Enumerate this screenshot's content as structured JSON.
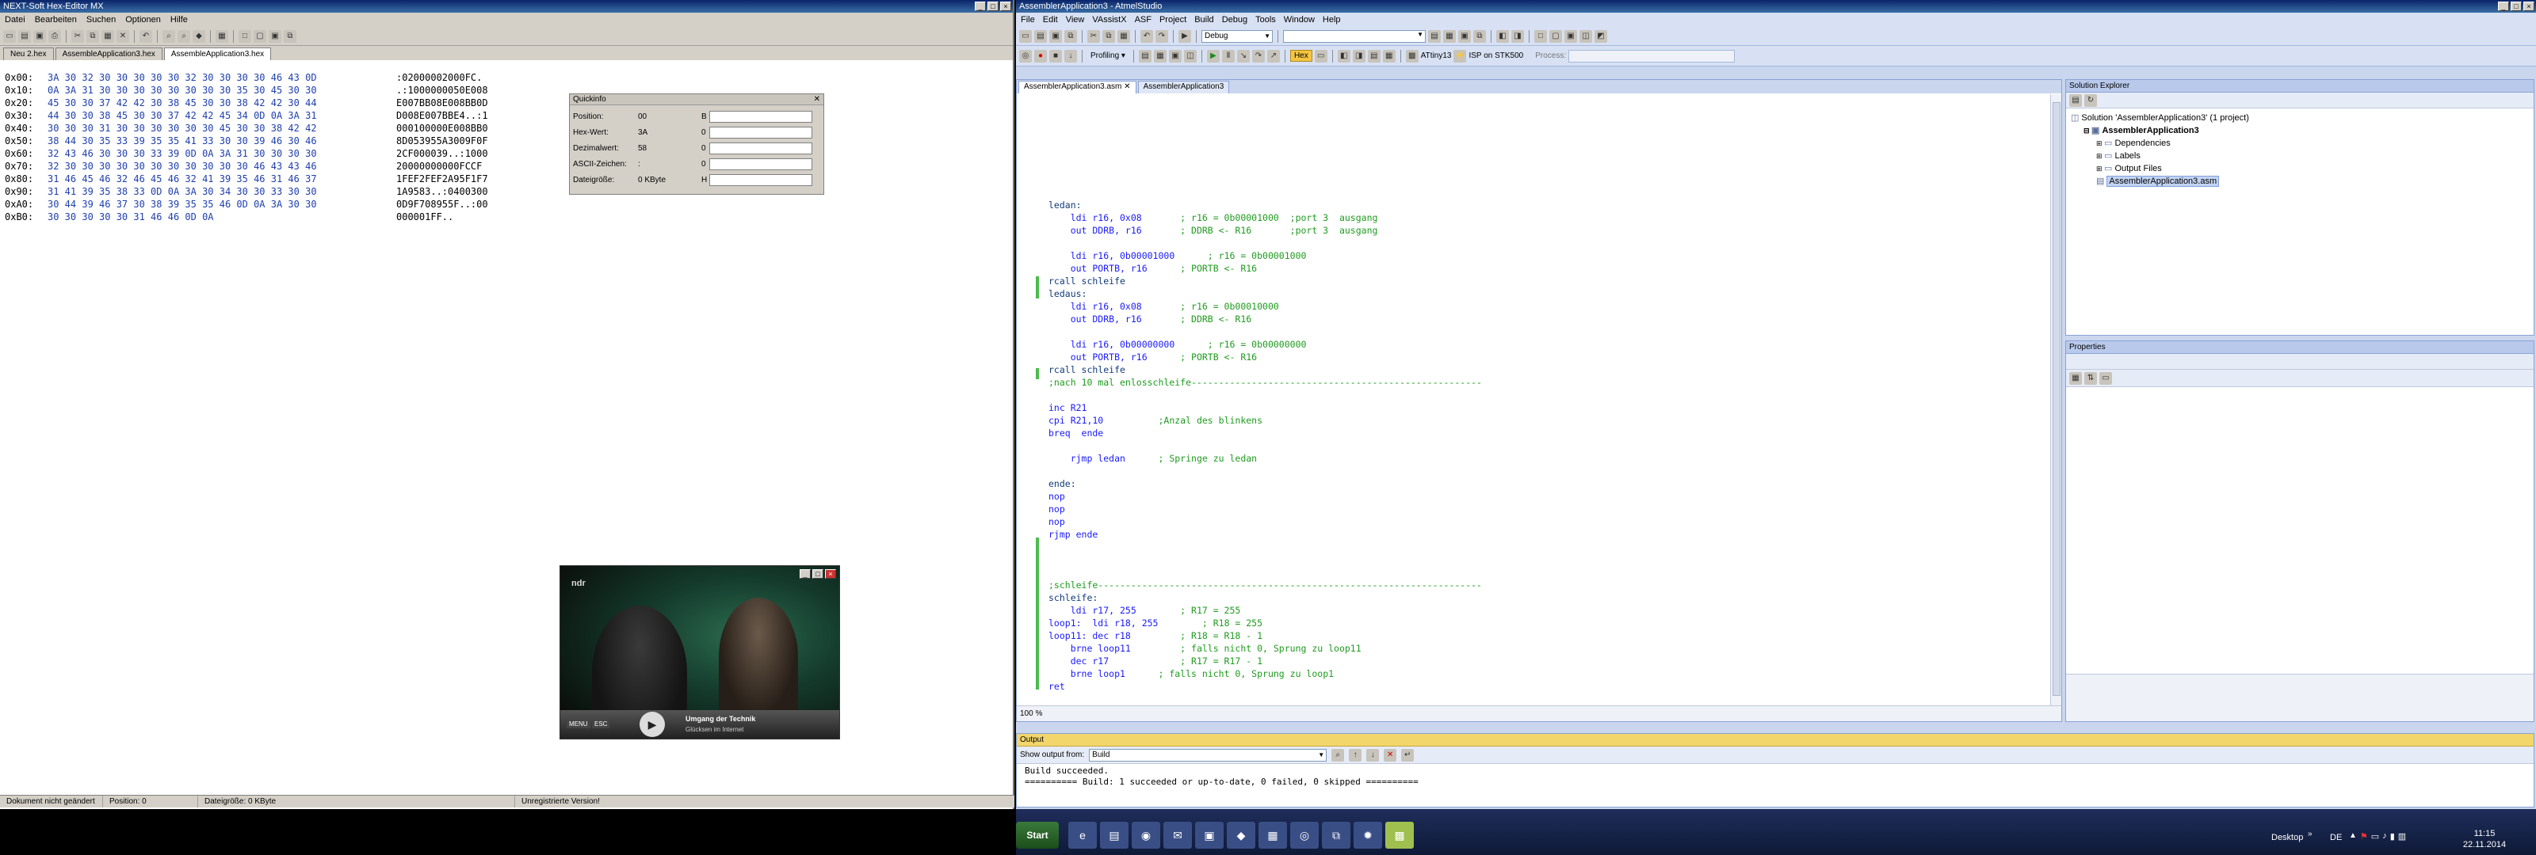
{
  "hexeditor": {
    "title": "NEXT-Soft Hex-Editor MX",
    "menu": [
      "Datei",
      "Bearbeiten",
      "Suchen",
      "Optionen",
      "Hilfe"
    ],
    "tabs": [
      "Neu 2.hex",
      "AssembleApplication3.hex",
      "AssembleApplication3.hex"
    ],
    "rows": [
      {
        "off": "0x00:",
        "hex": "3A 30 32 30 30 30 30 30 32 30 30 30 30 46 43 0D",
        "ascii": ":02000002000FC."
      },
      {
        "off": "0x10:",
        "hex": "0A 3A 31 30 30 30 30 30 30 30 30 35 30 45 30 30",
        "ascii": ".:1000000050E008"
      },
      {
        "off": "0x20:",
        "hex": "45 30 30 37 42 42 30 38 45 30 30 38 42 42 30 44",
        "ascii": "E007BB08E008BB0D"
      },
      {
        "off": "0x30:",
        "hex": "44 30 30 38 45 30 30 37 42 42 45 34 0D 0A 3A 31",
        "ascii": "D008E007BBE4..:1"
      },
      {
        "off": "0x40:",
        "hex": "30 30 30 31 30 30 30 30 30 30 45 30 30 38 42 42",
        "ascii": "000100000E008BB0"
      },
      {
        "off": "0x50:",
        "hex": "38 44 30 35 33 39 35 35 41 33 30 30 39 46 30 46",
        "ascii": "8D053955A3009F0F"
      },
      {
        "off": "0x60:",
        "hex": "32 43 46 30 30 30 33 39 0D 0A 3A 31 30 30 30 30",
        "ascii": "2CF000039..:1000"
      },
      {
        "off": "0x70:",
        "hex": "32 30 30 30 30 30 30 30 30 30 30 30 46 43 43 46",
        "ascii": "20000000000FCCF"
      },
      {
        "off": "0x80:",
        "hex": "31 46 45 46 32 46 45 46 32 41 39 35 46 31 46 37",
        "ascii": "1FEF2FEF2A95F1F7"
      },
      {
        "off": "0x90:",
        "hex": "31 41 39 35 38 33 0D 0A 3A 30 34 30 30 33 30 30",
        "ascii": "1A9583..:0400300"
      },
      {
        "off": "0xA0:",
        "hex": "30 44 39 46 37 30 38 39 35 35 46 0D 0A 3A 30 30",
        "ascii": "0D9F708955F..:00"
      },
      {
        "off": "0xB0:",
        "hex": "30 30 30 30 30 31 46 46 0D 0A",
        "ascii": "000001FF.."
      }
    ],
    "quickinfo": {
      "title": "Quickinfo",
      "fields": [
        {
          "label": "Position:",
          "value": "00",
          "col2": "B"
        },
        {
          "label": "Hex-Wert:",
          "value": "3A",
          "col2": "0"
        },
        {
          "label": "Dezimalwert:",
          "value": "58",
          "col2": "0"
        },
        {
          "label": "ASCII-Zeichen:",
          "value": ":",
          "col2": "0"
        },
        {
          "label": "Dateigröße:",
          "value": "0 KByte",
          "col2": "H"
        }
      ]
    },
    "status": [
      "Dokument nicht geändert",
      "Position: 0",
      "Dateigröße: 0 KByte",
      "Unregistrierte Version!"
    ]
  },
  "video": {
    "channel": "ndr",
    "subtitle": "Umgang der Technik",
    "subtitle2": "Glücksen im Internet",
    "buttons": [
      "MENU",
      "ESC"
    ]
  },
  "atmel": {
    "title": "AssemblerApplication3 - AtmelStudio",
    "menu": [
      "File",
      "Edit",
      "View",
      "VAssistX",
      "ASF",
      "Project",
      "Build",
      "Debug",
      "Tools",
      "Window",
      "Help"
    ],
    "config": "Debug",
    "profiling": "Profiling",
    "hex_label": "Hex",
    "device": "ATtiny13",
    "tool": "ISP on STK500",
    "process": "Process:",
    "tabs": [
      "AssemblerApplication3.asm",
      "AssemblerApplication3"
    ],
    "zoom": "100 %",
    "code": [
      {
        "t": "",
        "c": "cb"
      },
      {
        "t": "ledan:",
        "c": "cb"
      },
      {
        "t": "    ldi r16, 0x08       ; r16 = 0b00001000  ;port 3  ausgang",
        "c": "mix"
      },
      {
        "t": "    out DDRB, r16       ; DDRB <- R16       ;port 3  ausgang",
        "c": "mix"
      },
      {
        "t": "",
        "c": "cb"
      },
      {
        "t": "    ldi r16, 0b00001000      ; r16 = 0b00001000",
        "c": "mix"
      },
      {
        "t": "    out PORTB, r16      ; PORTB <- R16",
        "c": "mix"
      },
      {
        "t": "rcall schleife",
        "c": "cb"
      },
      {
        "t": "ledaus:",
        "c": "cb"
      },
      {
        "t": "    ldi r16, 0x08       ; r16 = 0b00010000",
        "c": "mix"
      },
      {
        "t": "    out DDRB, r16       ; DDRB <- R16",
        "c": "mix"
      },
      {
        "t": "",
        "c": "cb"
      },
      {
        "t": "    ldi r16, 0b00000000      ; r16 = 0b00000000",
        "c": "mix"
      },
      {
        "t": "    out PORTB, r16      ; PORTB <- R16",
        "c": "mix"
      },
      {
        "t": "rcall schleife",
        "c": "cb"
      },
      {
        "t": ";nach 10 mal enlosschleife-----------------------------------------------------",
        "c": "cg"
      },
      {
        "t": "",
        "c": "cb"
      },
      {
        "t": "inc R21",
        "c": "ck"
      },
      {
        "t": "cpi R21,10          ;Anzal des blinkens",
        "c": "mix"
      },
      {
        "t": "breq  ende",
        "c": "ck"
      },
      {
        "t": "",
        "c": "cb"
      },
      {
        "t": "    rjmp ledan      ; Springe zu ledan",
        "c": "mix"
      },
      {
        "t": "",
        "c": "cb"
      },
      {
        "t": "ende:",
        "c": "cb"
      },
      {
        "t": "nop",
        "c": "ck"
      },
      {
        "t": "nop",
        "c": "ck"
      },
      {
        "t": "nop",
        "c": "ck"
      },
      {
        "t": "rjmp ende",
        "c": "ck"
      },
      {
        "t": "",
        "c": "cb"
      },
      {
        "t": "",
        "c": "cb"
      },
      {
        "t": "",
        "c": "cb"
      },
      {
        "t": ";schleife----------------------------------------------------------------------",
        "c": "cg"
      },
      {
        "t": "schleife:",
        "c": "cb"
      },
      {
        "t": "    ldi r17, 255        ; R17 = 255",
        "c": "mix"
      },
      {
        "t": "loop1:  ldi r18, 255        ; R18 = 255",
        "c": "mix"
      },
      {
        "t": "loop11: dec r18         ; R18 = R18 - 1",
        "c": "mix"
      },
      {
        "t": "    brne loop11         ; falls nicht 0, Sprung zu loop11",
        "c": "mix"
      },
      {
        "t": "    dec r17             ; R17 = R17 - 1",
        "c": "mix"
      },
      {
        "t": "    brne loop1      ; falls nicht 0, Sprung zu loop1",
        "c": "mix"
      },
      {
        "t": "ret",
        "c": "ck"
      }
    ],
    "solution_explorer": {
      "title": "Solution Explorer",
      "items": [
        {
          "label": "Solution 'AssemblerApplication3' (1 project)",
          "level": 0
        },
        {
          "label": "AssemblerApplication3",
          "level": 1,
          "bold": true
        },
        {
          "label": "Dependencies",
          "level": 2
        },
        {
          "label": "Labels",
          "level": 2
        },
        {
          "label": "Output Files",
          "level": 2
        },
        {
          "label": "AssemblerApplication3.asm",
          "level": 2,
          "selected": true
        }
      ]
    },
    "properties": {
      "title": "Properties"
    },
    "output": {
      "title": "Output",
      "show_label": "Show output from:",
      "source": "Build",
      "lines": [
        "Build succeeded.",
        "========== Build: 1 succeeded or up-to-date, 0 failed, 0 skipped =========="
      ]
    }
  },
  "taskbar": {
    "start": "Start",
    "desktop": "Desktop",
    "lang": "DE",
    "time": "11:15",
    "date": "22.11.2014"
  }
}
